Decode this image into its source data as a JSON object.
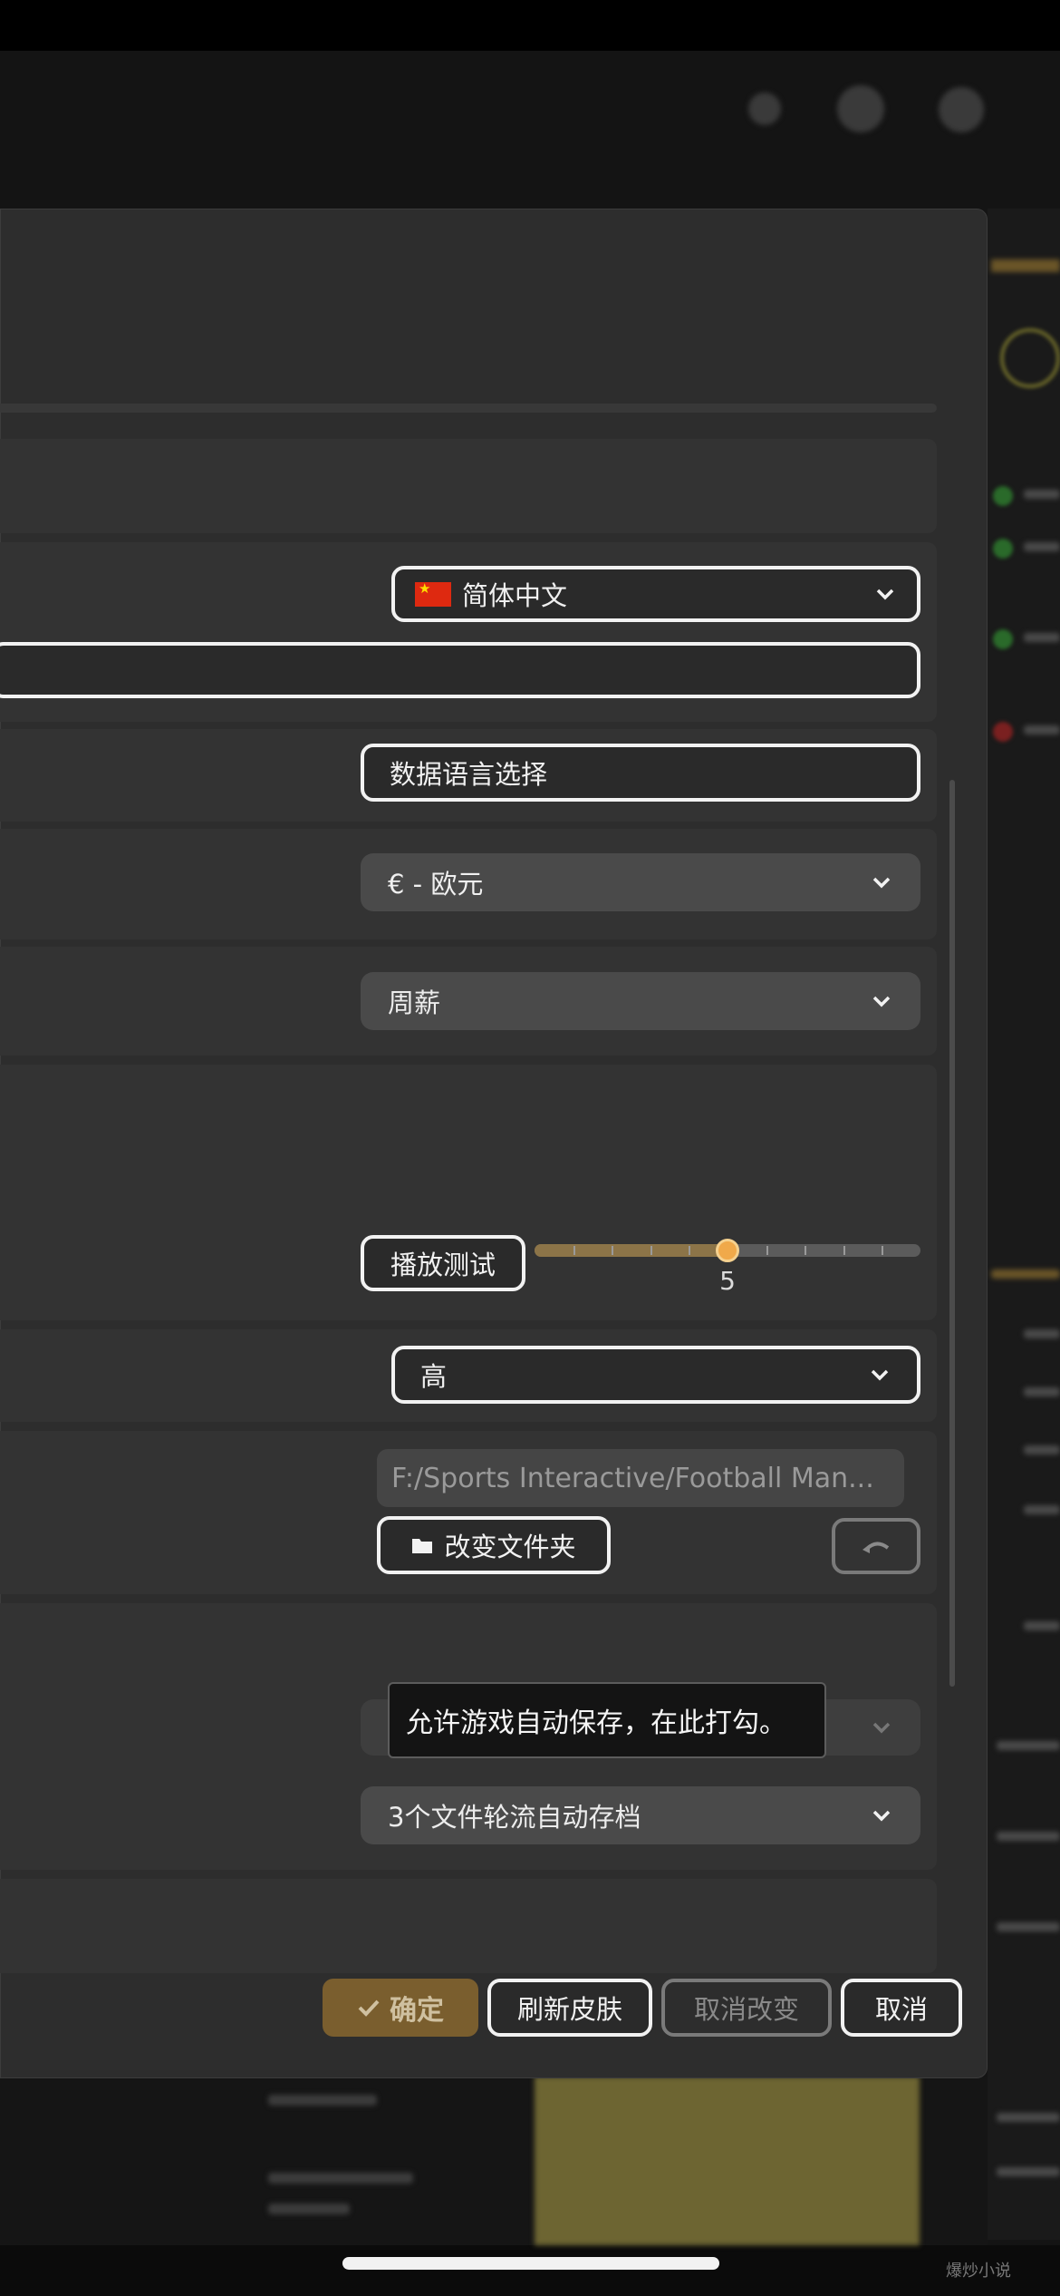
{
  "settings": {
    "language_value": "简体中文",
    "data_language_button": "数据语言选择",
    "currency_value": "€ - 欧元",
    "wage_value": "周薪",
    "play_test_button": "播放测试",
    "volume_level": 5,
    "volume_level_label": "5",
    "volume_max": 10,
    "quality_value": "高",
    "path_value": "F:/Sports Interactive/Football Man...",
    "change_folder_button": "改变文件夹",
    "autosave_tooltip": "允许游戏自动保存，在此打勾。",
    "autosave_rotation_value": "3个文件轮流自动存档"
  },
  "footer": {
    "confirm_label": "确定",
    "refresh_skin_label": "刷新皮肤",
    "cancel_changes_label": "取消改变",
    "cancel_label": "取消"
  },
  "watermark": "爆炒小说",
  "colors": {
    "accent": "#f0a94a",
    "confirm_bg": "#7a5e2e",
    "dialog_bg": "#2d2d2d",
    "row_bg": "#333333",
    "dropdown_fill": "#4a4a4a",
    "flag_red": "#de2910"
  },
  "icons": {
    "chevron": "chevron-down-icon",
    "folder": "folder-icon",
    "undo": "undo-icon",
    "check": "check-icon",
    "flag": "china-flag-icon"
  }
}
